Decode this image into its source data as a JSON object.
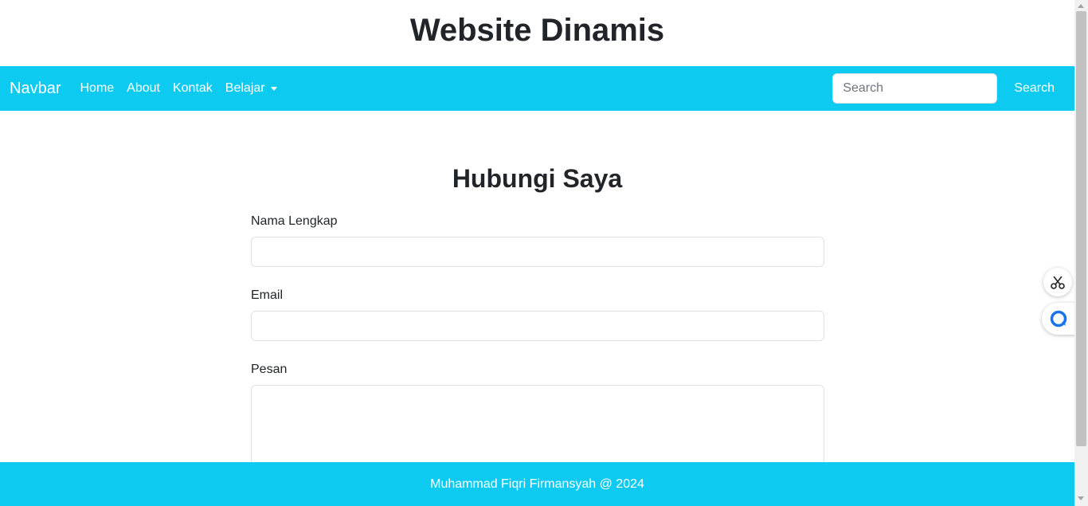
{
  "site": {
    "title": "Website Dinamis"
  },
  "navbar": {
    "brand": "Navbar",
    "links": [
      "Home",
      "About",
      "Kontak"
    ],
    "dropdown_label": "Belajar",
    "search_placeholder": "Search",
    "search_button": "Search",
    "accent_color": "#0dcaf0"
  },
  "main": {
    "heading": "Hubungi Saya",
    "fields": {
      "name_label": "Nama Lengkap",
      "email_label": "Email",
      "message_label": "Pesan"
    }
  },
  "footer": {
    "text": "Muhammad Fiqri Firmansyah @ 2024"
  },
  "floating": {
    "icons": [
      "scissors-icon",
      "chat-icon"
    ]
  }
}
